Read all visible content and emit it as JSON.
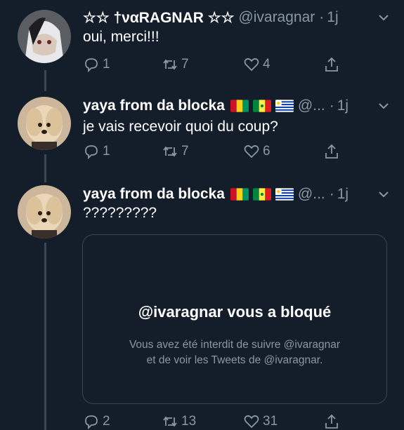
{
  "tweets": [
    {
      "name": "☆☆ †ναRAGNAR ☆☆",
      "handle": "@ivaragnar",
      "sep": "·",
      "time": "1j",
      "text": "oui, merci!!!",
      "replies": "1",
      "retweets": "7",
      "likes": "4"
    },
    {
      "name": "yaya from da blocka",
      "flags": [
        "guinea",
        "senegal",
        "uruguay"
      ],
      "handle": "@...",
      "sep": "·",
      "time": "1j",
      "text": "je vais recevoir quoi du coup?",
      "replies": "1",
      "retweets": "7",
      "likes": "6"
    },
    {
      "name": "yaya from da blocka",
      "flags": [
        "guinea",
        "senegal",
        "uruguay"
      ],
      "handle": "@...",
      "sep": "·",
      "time": "1j",
      "text": "?????????",
      "replies": "2",
      "retweets": "13",
      "likes": "31"
    }
  ],
  "blocked": {
    "title": "@ivaragnar vous a bloqué",
    "line1": "Vous avez été interdit de suivre @ivaragnar",
    "line2": "et de voir les Tweets de @ivaragnar."
  },
  "colors": {
    "background": "#141d2a",
    "secondary_text": "#8a97a4",
    "border": "#3a4652"
  }
}
